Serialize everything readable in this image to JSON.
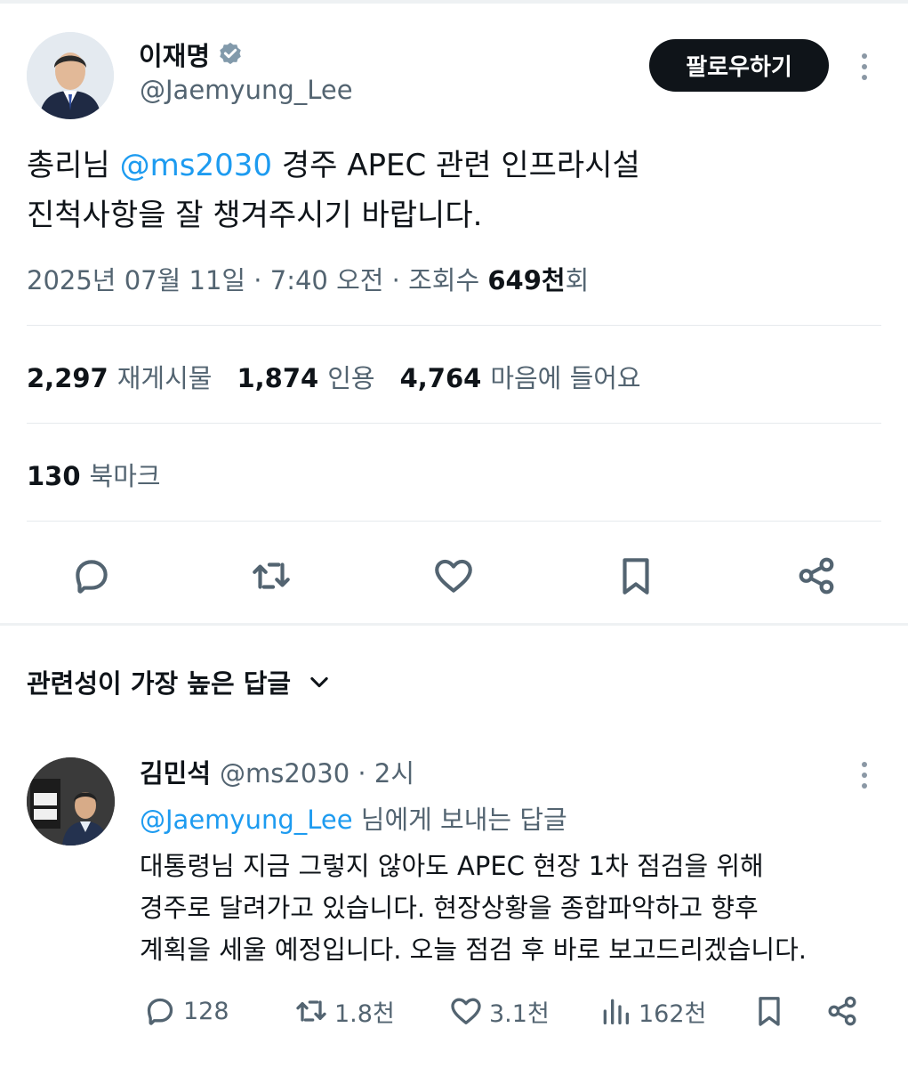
{
  "tweet": {
    "author_name": "이재명",
    "author_handle": "@Jaemyung_Lee",
    "follow_label": "팔로우하기",
    "text_before": "총리님 ",
    "mention": "@ms2030",
    "text_line1_after": " 경주 APEC 관련 인프라시설",
    "text_line2": "진척사항을 잘 챙겨주시기 바랍니다.",
    "timestamp": "2025년 07월 11일 · 7:40 오전 · 조회수 ",
    "views": "649천",
    "views_suffix": "회"
  },
  "stats": {
    "retweets_count": "2,297",
    "retweets_label": "재게시물",
    "quotes_count": "1,874",
    "quotes_label": "인용",
    "likes_count": "4,764",
    "likes_label": "마음에 들어요",
    "bookmarks_count": "130",
    "bookmarks_label": "북마크"
  },
  "replies_section": {
    "sort_label": "관련성이 가장 높은 답글"
  },
  "reply": {
    "author_name": "김민석",
    "author_handle_time": "@ms2030 · 2시",
    "reply_to_handle": "@Jaemyung_Lee",
    "reply_to_suffix": " 님에게 보내는 답글",
    "line1": "대통령님 지금 그렇지 않아도 APEC 현장 1차 점검을 위해",
    "line2": "경주로 달려가고 있습니다. 현장상황을 종합파악하고 향후",
    "line3": "계획을 세울 예정입니다. 오늘 점검 후 바로 보고드리겠습니다.",
    "replies": "128",
    "retweets": "1.8천",
    "likes": "3.1천",
    "views": "162천"
  },
  "colors": {
    "accent": "#1d9bf0",
    "text": "#0f1419",
    "muted": "#536471",
    "verified": "#829aab"
  },
  "icons": [
    "verified-icon",
    "more-icon",
    "reply-icon",
    "retweet-icon",
    "like-icon",
    "bookmark-icon",
    "share-icon",
    "chevron-down-icon",
    "views-icon"
  ]
}
